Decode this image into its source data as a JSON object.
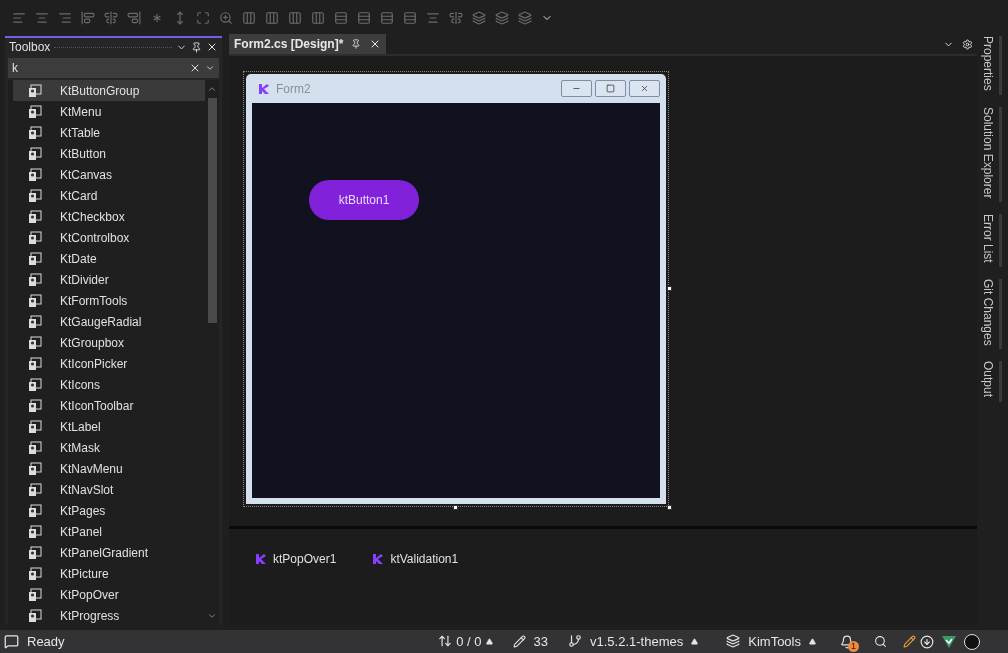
{
  "toolbox": {
    "title": "Toolbox",
    "search": {
      "value": "k"
    },
    "items": [
      {
        "label": "KtButtonGroup",
        "selected": true
      },
      {
        "label": "KtMenu",
        "selected": false
      },
      {
        "label": "KtTable",
        "selected": false
      },
      {
        "label": "KtButton",
        "selected": false
      },
      {
        "label": "KtCanvas",
        "selected": false
      },
      {
        "label": "KtCard",
        "selected": false
      },
      {
        "label": "KtCheckbox",
        "selected": false
      },
      {
        "label": "KtControlbox",
        "selected": false
      },
      {
        "label": "KtDate",
        "selected": false
      },
      {
        "label": "KtDivider",
        "selected": false
      },
      {
        "label": "KtFormTools",
        "selected": false
      },
      {
        "label": "KtGaugeRadial",
        "selected": false
      },
      {
        "label": "KtGroupbox",
        "selected": false
      },
      {
        "label": "KtIconPicker",
        "selected": false
      },
      {
        "label": "KtIcons",
        "selected": false
      },
      {
        "label": "KtIconToolbar",
        "selected": false
      },
      {
        "label": "KtLabel",
        "selected": false
      },
      {
        "label": "KtMask",
        "selected": false
      },
      {
        "label": "KtNavMenu",
        "selected": false
      },
      {
        "label": "KtNavSlot",
        "selected": false
      },
      {
        "label": "KtPages",
        "selected": false
      },
      {
        "label": "KtPanel",
        "selected": false
      },
      {
        "label": "KtPanelGradient",
        "selected": false
      },
      {
        "label": "KtPicture",
        "selected": false
      },
      {
        "label": "KtPopOver",
        "selected": false
      },
      {
        "label": "KtProgress",
        "selected": false
      }
    ]
  },
  "document_tab": {
    "label": "Form2.cs [Design]*",
    "selected": true
  },
  "form": {
    "title": "Form2",
    "button": "ktButton1"
  },
  "component_tray": [
    "ktPopOver1",
    "ktValidation1"
  ],
  "side_tabs": [
    "Properties",
    "Solution Explorer",
    "Error List",
    "Git Changes",
    "Output"
  ],
  "status_bar": {
    "status": "Ready",
    "changes": "0 / 0",
    "edits": "33",
    "branch": "v1.5.2.1-themes",
    "repo": "KimTools",
    "notifications": "1"
  }
}
